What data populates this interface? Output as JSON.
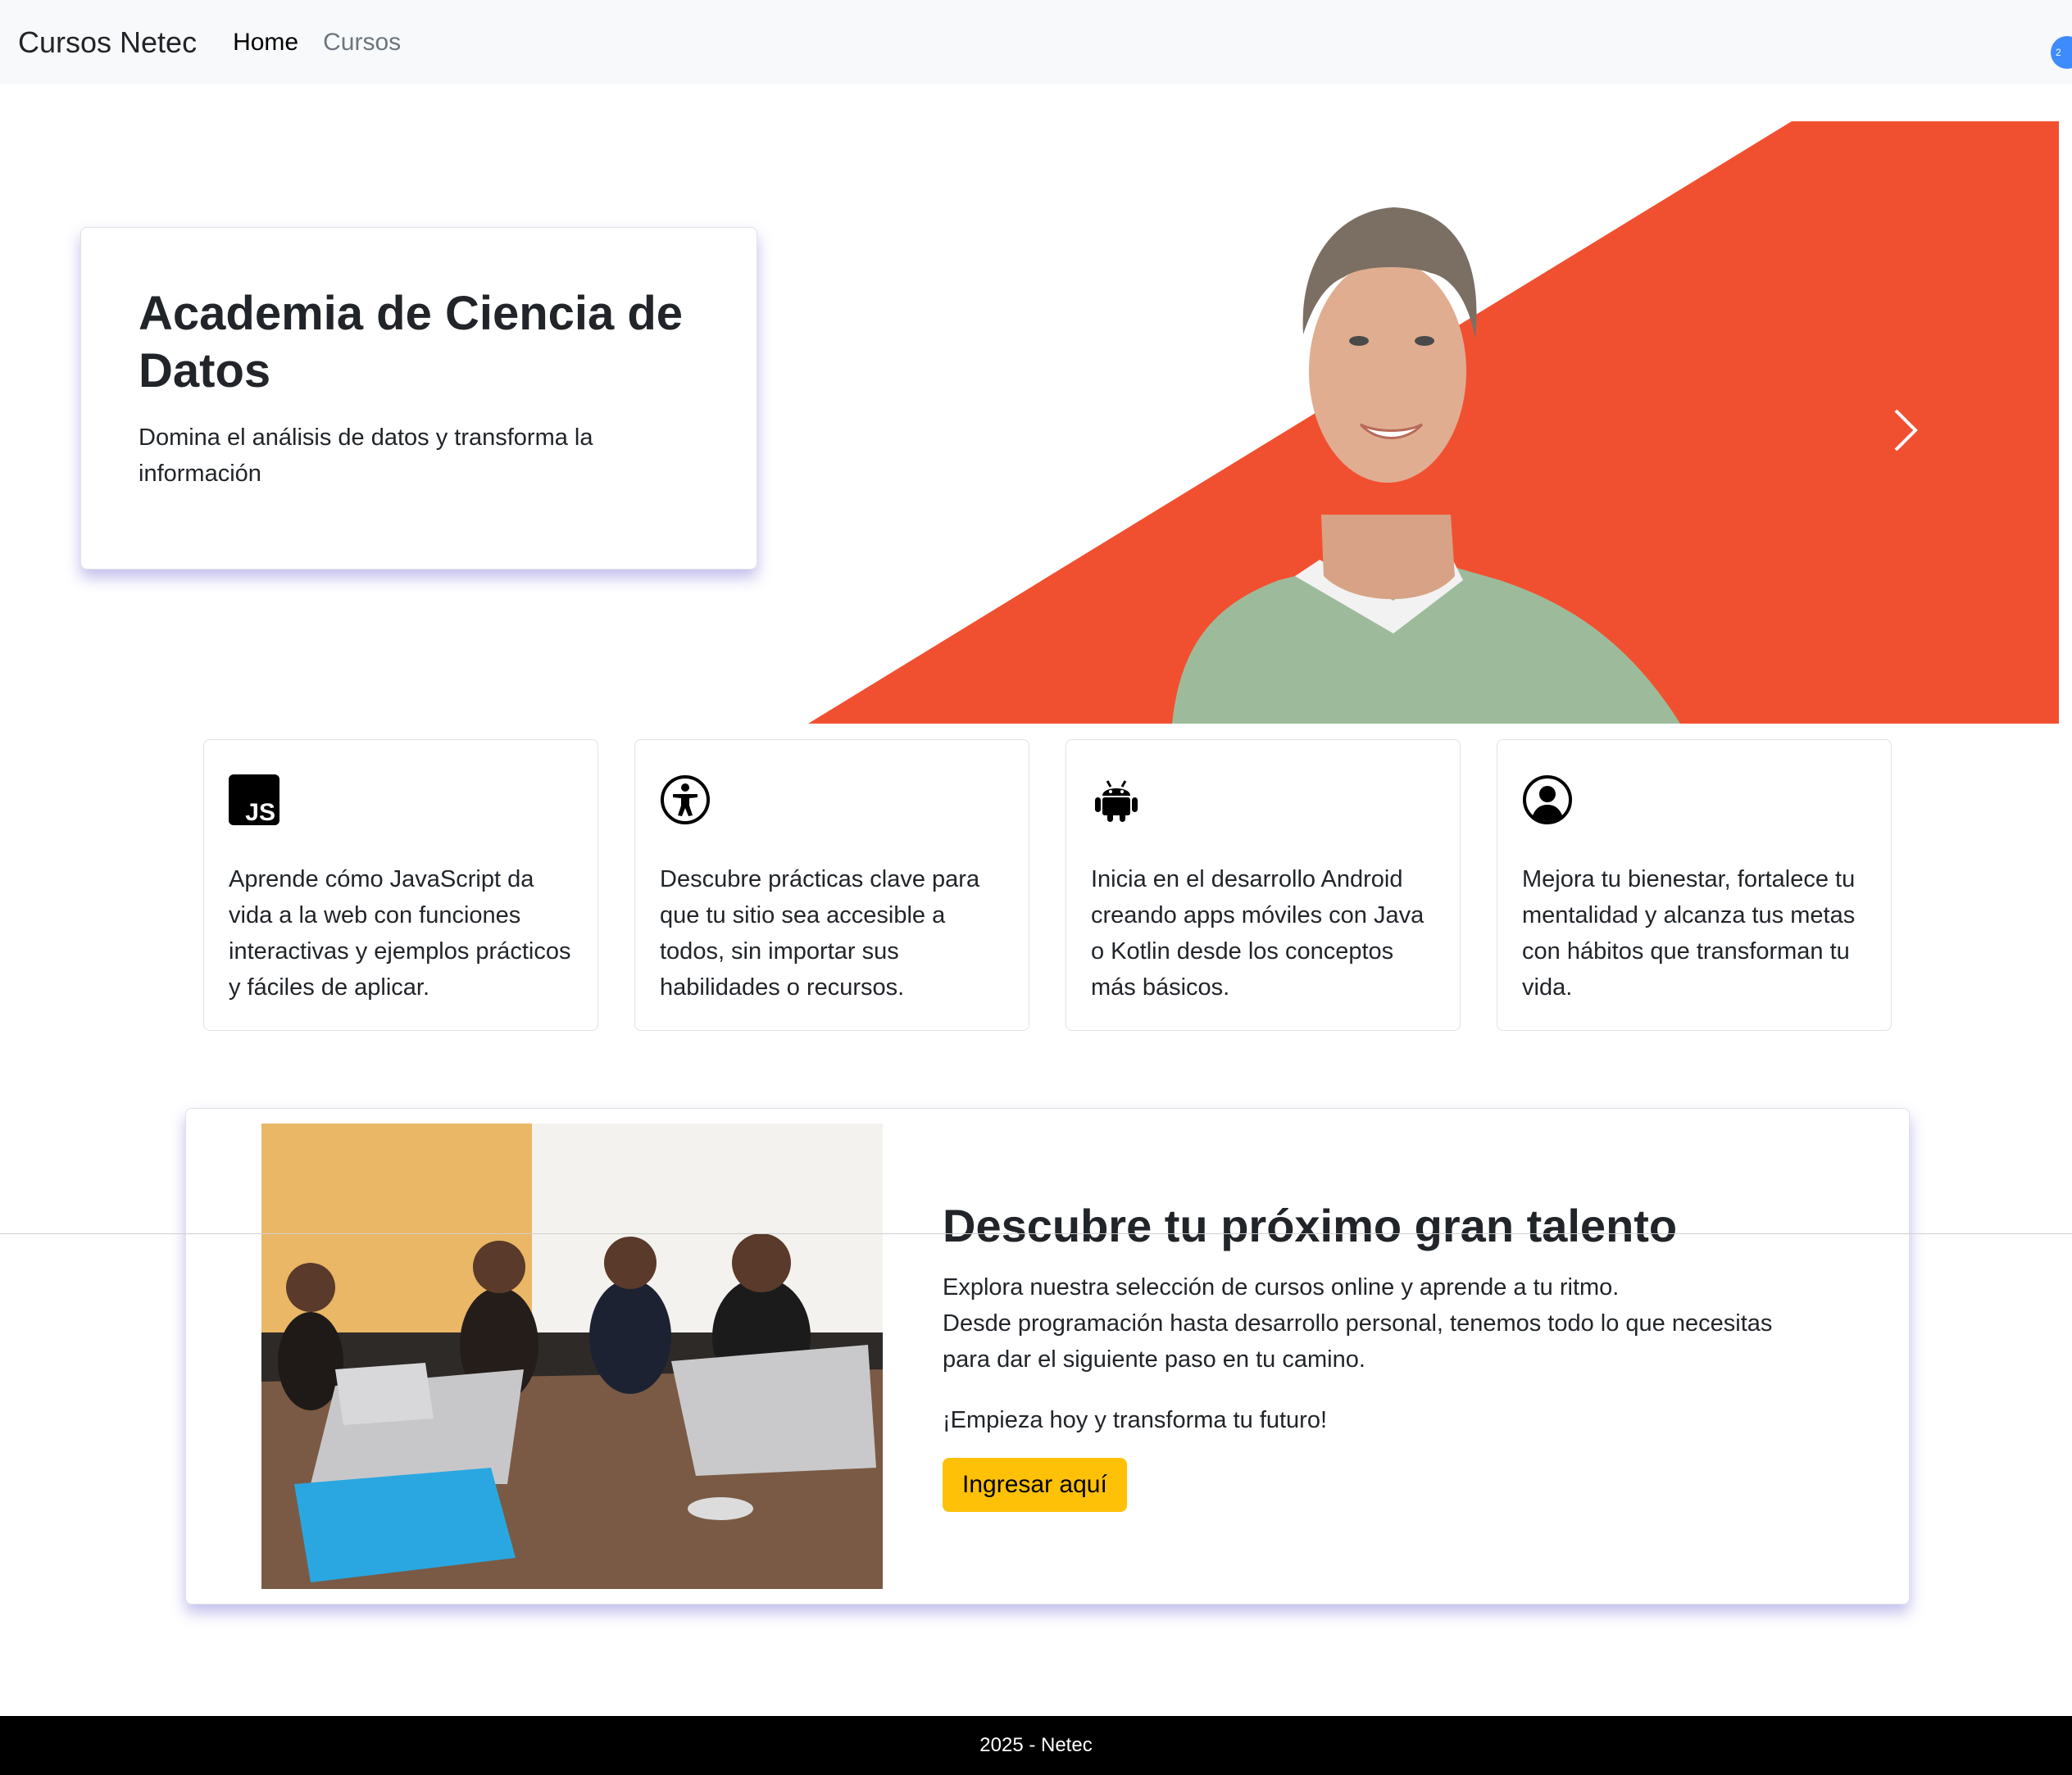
{
  "navbar": {
    "brand": "Cursos Netec",
    "links": [
      "Home",
      "Cursos"
    ],
    "badge_text": "2"
  },
  "hero": {
    "title": "Academia de Ciencia de Datos",
    "subtitle": "Domina el análisis de datos y transforma la información",
    "accent_color": "#f15030",
    "next_icon": "chevron-right-icon"
  },
  "features": [
    {
      "icon": "javascript-icon",
      "icon_label": "JS",
      "text": "Aprende cómo JavaScript da vida a la web con funciones interactivas y ejemplos prácticos y fáciles de aplicar."
    },
    {
      "icon": "accessibility-icon",
      "text": "Descubre prácticas clave para que tu sitio sea accesible a todos, sin importar sus habilidades o recursos."
    },
    {
      "icon": "android-icon",
      "text": "Inicia en el desarrollo Android creando apps móviles con Java o Kotlin desde los conceptos más básicos."
    },
    {
      "icon": "person-circle-icon",
      "text": "Mejora tu bienestar, fortalece tu mentalidad y alcanza tus metas con hábitos que transforman tu vida."
    }
  ],
  "promo": {
    "title": "Descubre tu próximo gran talento",
    "lines": [
      "Explora nuestra selección de cursos online y aprende a tu ritmo.",
      "Desde programación hasta desarrollo personal, tenemos todo lo que necesitas",
      "para dar el siguiente paso en tu camino."
    ],
    "cta_text": "¡Empieza hoy y transforma tu futuro!",
    "button_label": "Ingresar aquí",
    "button_color": "#ffc107"
  },
  "footer": {
    "text": "2025 - Netec"
  }
}
